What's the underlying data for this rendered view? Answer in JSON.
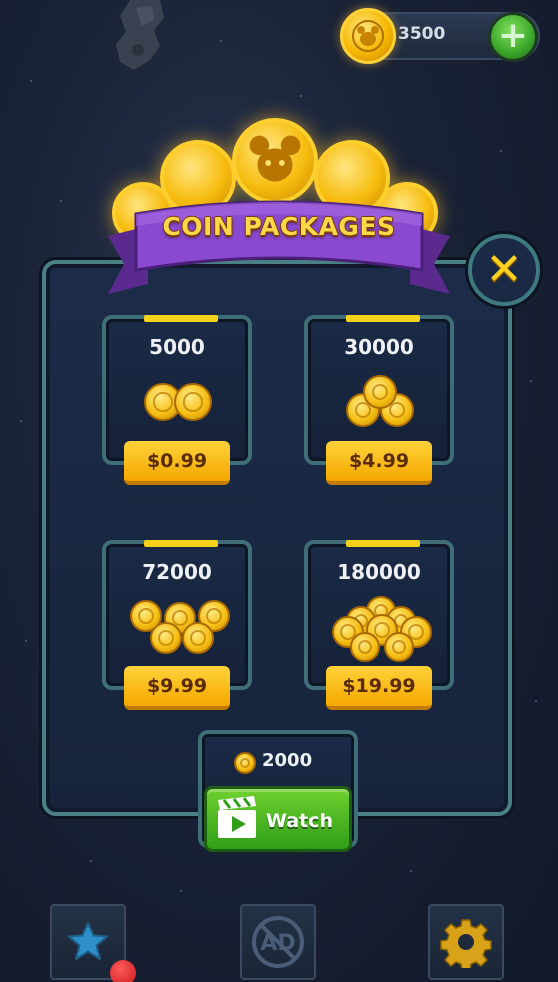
{
  "balance": {
    "value": "3500",
    "add_icon": "plus-icon"
  },
  "title": "COIN PACKAGES",
  "close_icon": "close-x-icon",
  "packages": [
    {
      "amount": "5000",
      "price": "$0.99",
      "coin_icon": "coin-pair-icon"
    },
    {
      "amount": "30000",
      "price": "$4.99",
      "coin_icon": "coin-stack-small-icon"
    },
    {
      "amount": "72000",
      "price": "$9.99",
      "coin_icon": "coin-pile-icon"
    },
    {
      "amount": "180000",
      "price": "$19.99",
      "coin_icon": "coin-heap-icon"
    }
  ],
  "reward": {
    "amount": "2000",
    "button_label": "Watch",
    "icon": "clapperboard-icon"
  },
  "bottom_bar": {
    "items": [
      {
        "name": "star-icon"
      },
      {
        "name": "no-ads-icon",
        "label": "AD"
      },
      {
        "name": "gear-icon"
      }
    ]
  },
  "colors": {
    "accent_gold": "#f5b800",
    "button_green": "#3ba52a",
    "ribbon_purple": "#7a3fb8",
    "panel_border": "#4a7f86"
  }
}
